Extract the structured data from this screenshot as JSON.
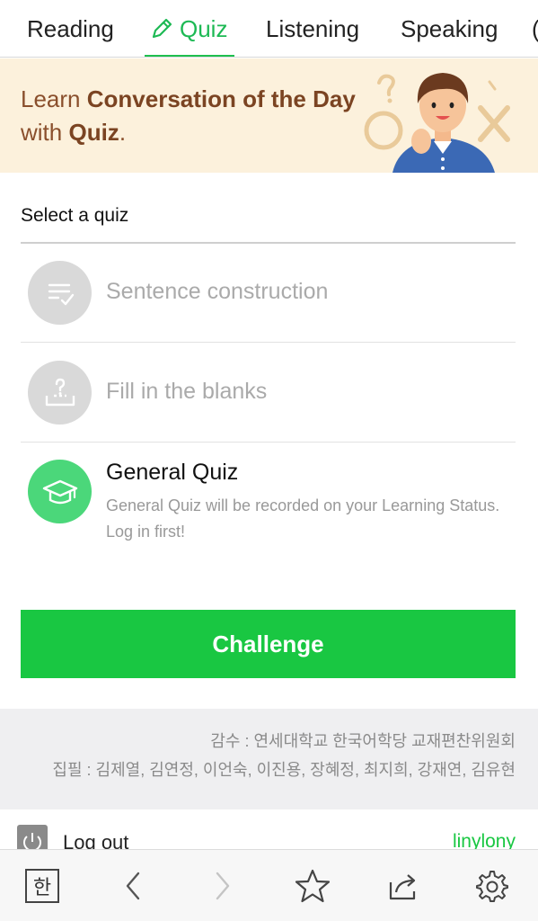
{
  "tabs": [
    {
      "label": "Reading",
      "active": false
    },
    {
      "label": "Quiz",
      "active": true
    },
    {
      "label": "Listening",
      "active": false
    },
    {
      "label": "Speaking",
      "active": false
    }
  ],
  "banner": {
    "line1_prefix": "Learn ",
    "line1_bold": "Conversation of the Day",
    "line2_prefix": "with ",
    "line2_bold": "Quiz",
    "line2_suffix": "."
  },
  "section_title": "Select a quiz",
  "quizzes": [
    {
      "label": "Sentence construction",
      "icon": "sentence-construction-icon",
      "enabled": false
    },
    {
      "label": "Fill in the blanks",
      "icon": "fill-blanks-icon",
      "enabled": false
    },
    {
      "label": "General Quiz",
      "icon": "graduation-cap-icon",
      "enabled": true,
      "description": "General Quiz will be recorded on your Learning Status.",
      "note": "Log in first!"
    }
  ],
  "challenge_label": "Challenge",
  "credits": {
    "line1": "감수 : 연세대학교 한국어학당 교재편찬위원회",
    "line2": "집필 : 김제열, 김연정, 이언숙, 이진용, 장혜정, 최지희, 강재연, 김유현"
  },
  "logout": {
    "label": "Log out",
    "user": "linylony"
  },
  "bottom_bar": {
    "hangul": "한"
  },
  "colors": {
    "accent": "#19c742",
    "banner_bg": "#fcf1dc",
    "banner_text": "#8a4f2c"
  }
}
